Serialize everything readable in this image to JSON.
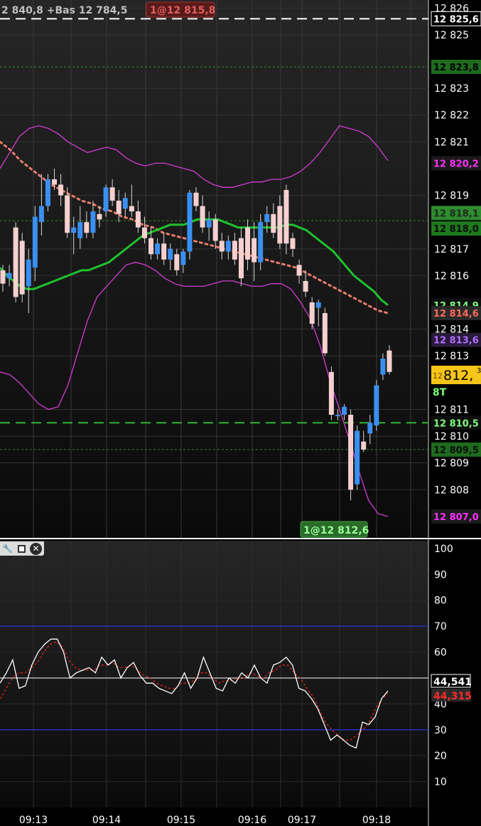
{
  "header": {
    "range_text": "2 840,8 +Bas 12 784,5",
    "order_tag": "1@12 815,8"
  },
  "price_panel": {
    "y_ticks": [
      "12 826",
      "12 825",
      "12 823",
      "12 822",
      "12 821",
      "12 819",
      "12 817",
      "12 816",
      "12 814",
      "12 813",
      "12 811",
      "12 810",
      "12 809",
      "12 808"
    ],
    "price_tags": [
      {
        "label": "12 825,6",
        "color": "#ffffff",
        "bg": "#000000",
        "border": "#ffffff"
      },
      {
        "label": "12 823,8",
        "color": "#000000",
        "bg": "#1f6b1f"
      },
      {
        "label": "12 820,2",
        "color": "#ff30ff",
        "bg": "#1a1a1a"
      },
      {
        "label": "12 818,1",
        "color": "#1c2a1c",
        "bg": "#2e8b2e"
      },
      {
        "label": "12 818,0",
        "color": "#0b0b0b",
        "bg": "#1e7a1e"
      },
      {
        "label": "12 814,9",
        "color": "#7dff7d",
        "bg": "#0f0f0f"
      },
      {
        "label": "12 814,6",
        "color": "#ff6a5a",
        "bg": "#2a2a2a"
      },
      {
        "label": "12 813,6",
        "color": "#b070ff",
        "bg": "#2a1a3a"
      },
      {
        "label": "12 810,5",
        "color": "#7dff7d",
        "bg": "#0f0f0f"
      },
      {
        "label": "12 809,5",
        "color": "#0b0b0b",
        "bg": "#1e6b1e"
      },
      {
        "label": "12 807,0",
        "color": "#ff30ff",
        "bg": "#1a1a1a"
      }
    ],
    "last_price": {
      "prefix": "12",
      "value": "812,",
      "suffix": "3"
    },
    "timer": "8T",
    "bottom_order_tag": "1@12 812,6"
  },
  "indicator_panel": {
    "y_ticks": [
      "100",
      "90",
      "80",
      "70",
      "60",
      "50",
      "40",
      "30",
      "20",
      "10"
    ],
    "value_white": "44,541",
    "value_red": "44,315"
  },
  "x_axis": {
    "labels": [
      "09:13",
      "09:14",
      "09:15",
      "09:16",
      "09:17",
      "09:18"
    ]
  },
  "toolbar": {
    "wrench_icon": "wrench-icon",
    "window_icon": "window-icon",
    "close_icon": "close-icon"
  },
  "chart_data": {
    "type": "candlestick",
    "price_ylim": [
      12806.2,
      12826.3
    ],
    "indicator_ylim": [
      0,
      103
    ],
    "x_labels": [
      "09:13",
      "09:14",
      "09:15",
      "09:16",
      "09:17",
      "09:18"
    ],
    "candles": [
      {
        "o": 12816.2,
        "h": 12816.4,
        "l": 12815.4,
        "c": 12815.7,
        "dir": "down"
      },
      {
        "o": 12815.9,
        "h": 12816.4,
        "l": 12815.6,
        "c": 12816.1,
        "dir": "up"
      },
      {
        "o": 12817.8,
        "h": 12818.0,
        "l": 12815.0,
        "c": 12815.2,
        "dir": "down"
      },
      {
        "o": 12817.3,
        "h": 12817.6,
        "l": 12815.0,
        "c": 12815.3,
        "dir": "down"
      },
      {
        "o": 12815.6,
        "h": 12817.0,
        "l": 12814.6,
        "c": 12816.6,
        "dir": "up"
      },
      {
        "o": 12816.3,
        "h": 12818.6,
        "l": 12815.8,
        "c": 12818.2,
        "dir": "up"
      },
      {
        "o": 12818.0,
        "h": 12819.8,
        "l": 12817.5,
        "c": 12818.6,
        "dir": "up"
      },
      {
        "o": 12818.6,
        "h": 12819.8,
        "l": 12818.4,
        "c": 12819.6,
        "dir": "up"
      },
      {
        "o": 12819.6,
        "h": 12820.0,
        "l": 12819.2,
        "c": 12819.4,
        "dir": "down"
      },
      {
        "o": 12819.4,
        "h": 12819.8,
        "l": 12818.6,
        "c": 12819.0,
        "dir": "down"
      },
      {
        "o": 12819.0,
        "h": 12819.3,
        "l": 12817.4,
        "c": 12817.6,
        "dir": "down"
      },
      {
        "o": 12817.6,
        "h": 12818.2,
        "l": 12816.8,
        "c": 12817.8,
        "dir": "up"
      },
      {
        "o": 12817.4,
        "h": 12818.6,
        "l": 12817.0,
        "c": 12818.0,
        "dir": "up"
      },
      {
        "o": 12818.0,
        "h": 12818.4,
        "l": 12817.4,
        "c": 12817.6,
        "dir": "down"
      },
      {
        "o": 12817.6,
        "h": 12818.8,
        "l": 12817.4,
        "c": 12818.4,
        "dir": "up"
      },
      {
        "o": 12818.3,
        "h": 12818.6,
        "l": 12817.8,
        "c": 12818.1,
        "dir": "down"
      },
      {
        "o": 12818.4,
        "h": 12819.4,
        "l": 12818.2,
        "c": 12819.3,
        "dir": "up"
      },
      {
        "o": 12819.3,
        "h": 12819.6,
        "l": 12818.6,
        "c": 12818.8,
        "dir": "down"
      },
      {
        "o": 12818.8,
        "h": 12819.2,
        "l": 12818.0,
        "c": 12818.3,
        "dir": "down"
      },
      {
        "o": 12818.5,
        "h": 12819.1,
        "l": 12818.2,
        "c": 12818.9,
        "dir": "up"
      },
      {
        "o": 12818.6,
        "h": 12819.4,
        "l": 12818.2,
        "c": 12818.4,
        "dir": "down"
      },
      {
        "o": 12818.4,
        "h": 12818.8,
        "l": 12817.6,
        "c": 12817.8,
        "dir": "down"
      },
      {
        "o": 12817.8,
        "h": 12818.2,
        "l": 12817.2,
        "c": 12817.4,
        "dir": "down"
      },
      {
        "o": 12817.4,
        "h": 12817.8,
        "l": 12816.6,
        "c": 12816.8,
        "dir": "down"
      },
      {
        "o": 12816.8,
        "h": 12817.4,
        "l": 12816.6,
        "c": 12817.2,
        "dir": "up"
      },
      {
        "o": 12817.2,
        "h": 12817.6,
        "l": 12816.4,
        "c": 12816.6,
        "dir": "down"
      },
      {
        "o": 12816.6,
        "h": 12817.2,
        "l": 12816.2,
        "c": 12817.0,
        "dir": "up"
      },
      {
        "o": 12816.8,
        "h": 12817.0,
        "l": 12816.0,
        "c": 12816.2,
        "dir": "down"
      },
      {
        "o": 12816.4,
        "h": 12817.0,
        "l": 12816.1,
        "c": 12816.9,
        "dir": "up"
      },
      {
        "o": 12816.9,
        "h": 12819.2,
        "l": 12816.6,
        "c": 12819.1,
        "dir": "up"
      },
      {
        "o": 12819.1,
        "h": 12819.3,
        "l": 12818.4,
        "c": 12818.6,
        "dir": "down"
      },
      {
        "o": 12818.6,
        "h": 12819.0,
        "l": 12817.6,
        "c": 12817.8,
        "dir": "down"
      },
      {
        "o": 12817.8,
        "h": 12818.4,
        "l": 12817.3,
        "c": 12818.1,
        "dir": "up"
      },
      {
        "o": 12818.1,
        "h": 12818.3,
        "l": 12817.0,
        "c": 12817.3,
        "dir": "down"
      },
      {
        "o": 12817.3,
        "h": 12817.6,
        "l": 12816.6,
        "c": 12816.9,
        "dir": "down"
      },
      {
        "o": 12816.9,
        "h": 12817.5,
        "l": 12816.6,
        "c": 12817.3,
        "dir": "up"
      },
      {
        "o": 12817.3,
        "h": 12817.6,
        "l": 12816.4,
        "c": 12816.6,
        "dir": "down"
      },
      {
        "o": 12817.4,
        "h": 12817.8,
        "l": 12815.6,
        "c": 12815.9,
        "dir": "down"
      },
      {
        "o": 12817.8,
        "h": 12818.1,
        "l": 12816.2,
        "c": 12816.6,
        "dir": "down"
      },
      {
        "o": 12817.4,
        "h": 12818.0,
        "l": 12815.8,
        "c": 12816.5,
        "dir": "down"
      },
      {
        "o": 12816.5,
        "h": 12818.3,
        "l": 12816.2,
        "c": 12818.0,
        "dir": "up"
      },
      {
        "o": 12818.0,
        "h": 12818.6,
        "l": 12817.6,
        "c": 12818.3,
        "dir": "up"
      },
      {
        "o": 12818.3,
        "h": 12818.7,
        "l": 12817.4,
        "c": 12817.6,
        "dir": "down"
      },
      {
        "o": 12818.6,
        "h": 12819.0,
        "l": 12817.0,
        "c": 12817.2,
        "dir": "down"
      },
      {
        "o": 12819.2,
        "h": 12819.4,
        "l": 12816.8,
        "c": 12817.2,
        "dir": "down"
      },
      {
        "o": 12817.4,
        "h": 12817.6,
        "l": 12816.7,
        "c": 12817.0,
        "dir": "down"
      },
      {
        "o": 12816.4,
        "h": 12816.6,
        "l": 12815.7,
        "c": 12816.0,
        "dir": "down"
      },
      {
        "o": 12815.8,
        "h": 12816.2,
        "l": 12815.2,
        "c": 12815.4,
        "dir": "down"
      },
      {
        "o": 12815.0,
        "h": 12815.2,
        "l": 12814.0,
        "c": 12814.2,
        "dir": "down"
      },
      {
        "o": 12815.0,
        "h": 12815.1,
        "l": 12814.1,
        "c": 12814.8,
        "dir": "up"
      },
      {
        "o": 12814.6,
        "h": 12814.8,
        "l": 12813.0,
        "c": 12813.1,
        "dir": "down"
      },
      {
        "o": 12812.4,
        "h": 12812.6,
        "l": 12810.6,
        "c": 12810.8,
        "dir": "down"
      },
      {
        "o": 12810.8,
        "h": 12811.0,
        "l": 12810.6,
        "c": 12810.8,
        "dir": "up"
      },
      {
        "o": 12810.8,
        "h": 12811.2,
        "l": 12810.6,
        "c": 12811.1,
        "dir": "up"
      },
      {
        "o": 12810.8,
        "h": 12811.0,
        "l": 12807.6,
        "c": 12808.0,
        "dir": "down"
      },
      {
        "o": 12808.2,
        "h": 12810.4,
        "l": 12808.0,
        "c": 12810.2,
        "dir": "up"
      },
      {
        "o": 12809.8,
        "h": 12810.2,
        "l": 12809.4,
        "c": 12809.5,
        "dir": "down"
      },
      {
        "o": 12810.1,
        "h": 12810.8,
        "l": 12809.7,
        "c": 12810.5,
        "dir": "up"
      },
      {
        "o": 12810.4,
        "h": 12812.1,
        "l": 12810.2,
        "c": 12811.9,
        "dir": "up"
      },
      {
        "o": 12812.3,
        "h": 12813.1,
        "l": 12812.1,
        "c": 12812.9,
        "dir": "up"
      },
      {
        "o": 12812.4,
        "h": 12813.4,
        "l": 12812.3,
        "c": 12813.2,
        "dir": "down"
      }
    ],
    "series": [
      {
        "key": "sma_green",
        "color": "#1fc12d",
        "values": [
          12816.3,
          12816.0,
          12815.8,
          12815.6,
          12815.5,
          12815.5,
          12815.6,
          12815.7,
          12815.8,
          12815.9,
          12816.0,
          12816.1,
          12816.2,
          12816.2,
          12816.3,
          12816.4,
          12816.5,
          12816.7,
          12816.9,
          12817.1,
          12817.3,
          12817.5,
          12817.6,
          12817.7,
          12817.8,
          12817.9,
          12817.9,
          12817.9,
          12818.0,
          12818.1,
          12818.1,
          12818.1,
          12818.1,
          12818.0,
          12817.9,
          12817.8,
          12817.8,
          12817.8,
          12817.8,
          12817.8,
          12817.8,
          12817.8,
          12817.9,
          12817.9,
          12817.8,
          12817.7,
          12817.5,
          12817.3,
          12817.1,
          12816.9,
          12816.6,
          12816.3,
          12816.0,
          12815.8,
          12815.6,
          12815.4,
          12815.1,
          12814.9
        ]
      },
      {
        "key": "ema_dotted",
        "color": "#e87d6c",
        "values": [
          12821.0,
          12820.7,
          12820.3,
          12820.0,
          12819.7,
          12819.4,
          12819.2,
          12819.0,
          12818.8,
          12818.7,
          12818.5,
          12818.4,
          12818.2,
          12818.1,
          12817.9,
          12817.8,
          12817.6,
          12817.5,
          12817.4,
          12817.3,
          12817.2,
          12817.1,
          12817.0,
          12816.9,
          12816.8,
          12816.7,
          12816.6,
          12816.5,
          12816.4,
          12816.3,
          12816.1,
          12815.9,
          12815.7,
          12815.5,
          12815.3,
          12815.1,
          12814.9,
          12814.7,
          12814.6
        ]
      },
      {
        "key": "bb_upper",
        "color": "#d23cd2",
        "values": [
          12820.0,
          12820.6,
          12821.2,
          12821.5,
          12821.6,
          12821.5,
          12821.3,
          12821.0,
          12820.8,
          12820.6,
          12820.7,
          12820.8,
          12820.7,
          12820.4,
          12820.2,
          12820.1,
          12820.2,
          12820.2,
          12820.1,
          12820.0,
          12819.9,
          12819.6,
          12819.4,
          12819.3,
          12819.3,
          12819.4,
          12819.5,
          12819.5,
          12819.6,
          12819.6,
          12819.7,
          12819.9,
          12820.2,
          12820.6,
          12821.1,
          12821.6,
          12821.5,
          12821.4,
          12821.2,
          12820.8,
          12820.3
        ]
      },
      {
        "key": "bb_lower",
        "color": "#d23cd2",
        "values": [
          12812.4,
          12812.3,
          12812.0,
          12811.6,
          12811.2,
          12811.0,
          12811.1,
          12811.9,
          12813.1,
          12814.3,
          12815.2,
          12815.6,
          12816.0,
          12816.4,
          12816.5,
          12816.4,
          12816.2,
          12815.9,
          12815.7,
          12815.6,
          12815.6,
          12815.6,
          12815.7,
          12815.8,
          12815.8,
          12815.7,
          12815.6,
          12815.6,
          12815.7,
          12815.7,
          12815.5,
          12815.0,
          12814.4,
          12813.4,
          12812.1,
          12811.0,
          12809.9,
          12808.7,
          12807.6,
          12807.1,
          12807.0
        ]
      },
      {
        "key": "rsi_white",
        "color": "#ffffff",
        "values": [
          48,
          52,
          57,
          46,
          47,
          55,
          60,
          63,
          65,
          65,
          60,
          50,
          52,
          53,
          54,
          52,
          58,
          55,
          57,
          50,
          54,
          56,
          51,
          48,
          48,
          46,
          45,
          44,
          47,
          52,
          46,
          50,
          58,
          52,
          46,
          45,
          50,
          48,
          52,
          50,
          55,
          50,
          48,
          55,
          56,
          58,
          55,
          46,
          45,
          42,
          38,
          32,
          26,
          28,
          26,
          24,
          23,
          33,
          32,
          35,
          42,
          45
        ]
      },
      {
        "key": "rsi_red",
        "color": "#e0211c",
        "values": [
          42,
          46,
          50,
          52,
          52,
          54,
          56,
          60,
          63,
          64,
          62,
          57,
          54,
          53,
          53,
          53,
          55,
          55,
          56,
          54,
          54,
          55,
          53,
          51,
          50,
          48,
          47,
          46,
          46,
          48,
          48,
          49,
          52,
          52,
          50,
          48,
          49,
          49,
          50,
          50,
          52,
          51,
          50,
          52,
          53,
          55,
          55,
          52,
          50,
          46,
          43,
          38,
          33,
          30,
          28,
          26,
          26,
          28,
          30,
          33,
          38,
          42,
          44
        ]
      }
    ],
    "horizontal_levels": [
      {
        "y": 12825.6,
        "style": "dashed",
        "color": "#ffffff"
      },
      {
        "y": 12823.8,
        "style": "dotted",
        "color": "#2e8b2e"
      },
      {
        "y": 12818.05,
        "style": "dotted",
        "color": "#2e8b2e"
      },
      {
        "y": 12810.5,
        "style": "dashed",
        "color": "#31b331"
      },
      {
        "y": 12809.5,
        "style": "dotted",
        "color": "#2e8b2e"
      }
    ],
    "rsi_levels": [
      70,
      30,
      50
    ]
  }
}
